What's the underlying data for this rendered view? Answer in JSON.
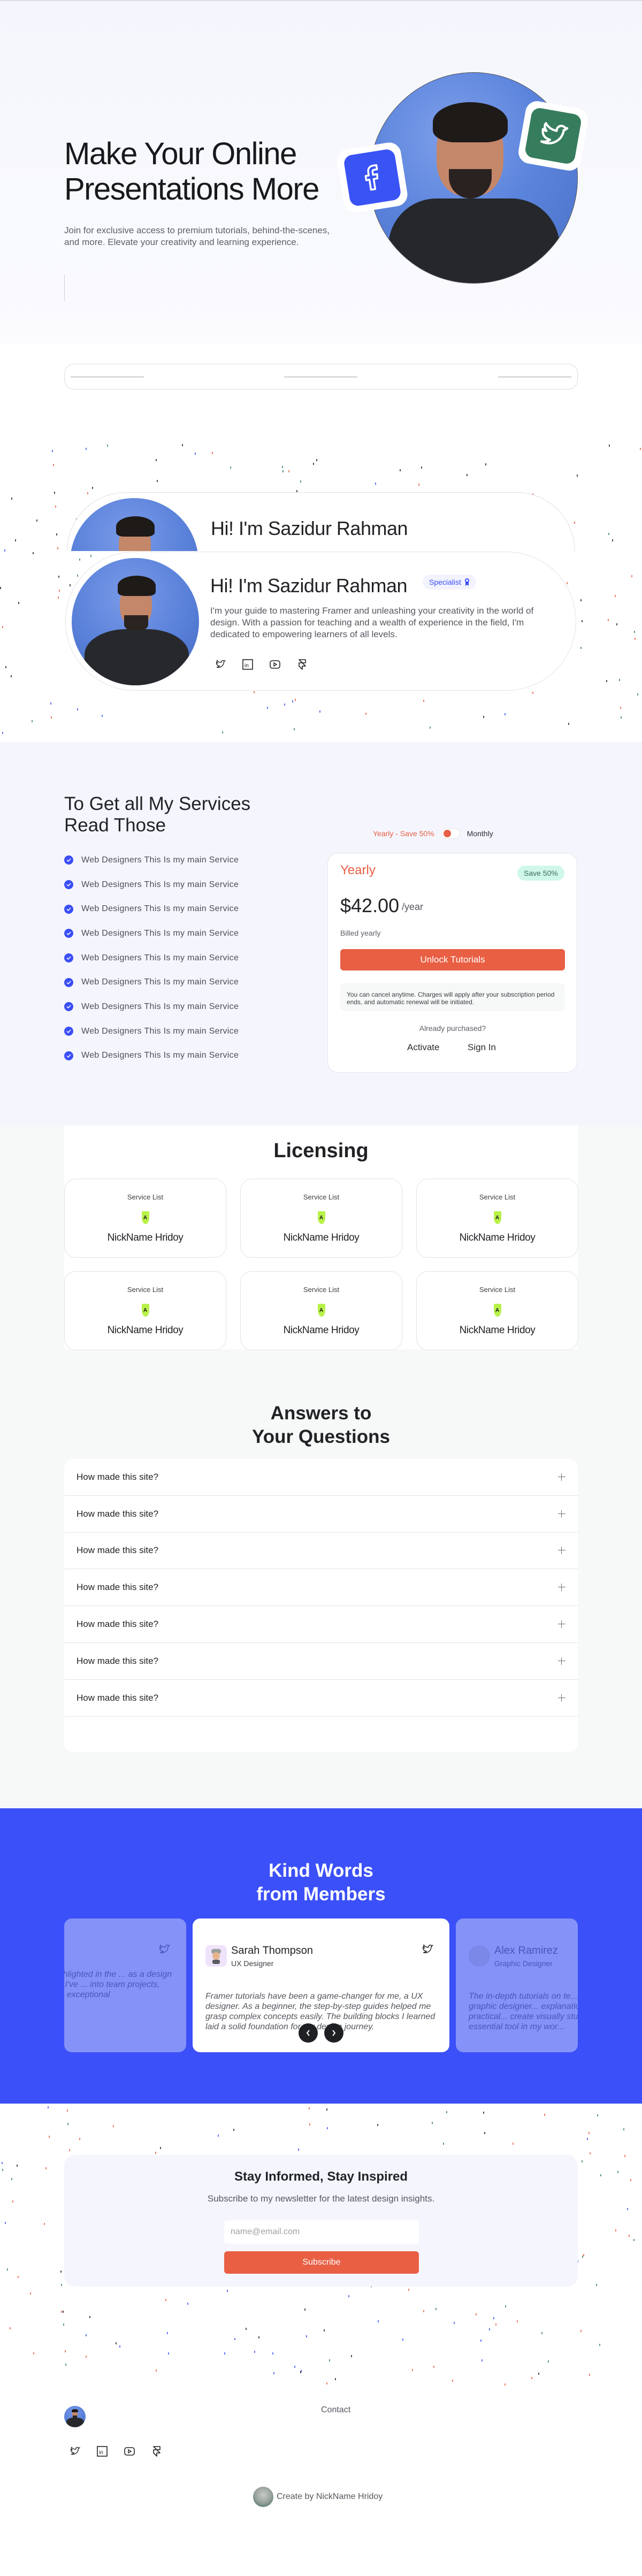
{
  "hero": {
    "title": "Make Your Online Presentations More",
    "subtitle": "Join for exclusive access to premium tutorials, behind-the-scenes, and more. Elevate your creativity and learning experience.",
    "badges": [
      {
        "icon": "facebook-icon",
        "color": "#3a53f5"
      },
      {
        "icon": "twitter-icon",
        "color": "#367d5d"
      }
    ]
  },
  "about": {
    "back_name": "Hi! I'm Sazidur Rahman",
    "name": "Hi! I'm Sazidur Rahman",
    "badge": "Specialist",
    "description": "I'm your guide to mastering Framer and unleashing your creativity in the world of design. With a passion for teaching and a wealth of experience in the field, I'm dedicated to empowering learners of all levels.",
    "socials": [
      "twitter-icon",
      "linkedin-icon",
      "youtube-icon",
      "framer-icon"
    ]
  },
  "services": {
    "title": "To Get all My Services Read Those",
    "items": [
      "Web Designers This Is my main Service",
      "Web Designers This Is my main Service",
      "Web Designers This Is my main Service",
      "Web Designers This Is my main Service",
      "Web Designers This Is my main Service",
      "Web Designers This Is my main Service",
      "Web Designers This Is my main Service",
      "Web Designers This Is my main Service",
      "Web Designers This Is my main Service"
    ]
  },
  "pricing": {
    "toggle_yearly": "Yearly - Save 50%",
    "toggle_monthly": "Monthly",
    "toggle_state": "yearly",
    "plan": "Yearly",
    "save_badge": "Save 50%",
    "price": "$42.00",
    "period": "/year",
    "billed": "Billed yearly",
    "cta": "Unlock Tutorials",
    "note": "You can cancel anytime. Charges will apply after your subscription period ends, and automatic renewal will be initiated.",
    "already": "Already purchased?",
    "activate": "Activate",
    "signin": "Sign In",
    "accent": "#e95f44"
  },
  "licensing": {
    "title": "Licensing",
    "cards": [
      {
        "label": "Service List",
        "name": "NickName Hridoy"
      },
      {
        "label": "Service List",
        "name": "NickName Hridoy"
      },
      {
        "label": "Service List",
        "name": "NickName Hridoy"
      },
      {
        "label": "Service List",
        "name": "NickName Hridoy"
      },
      {
        "label": "Service List",
        "name": "NickName Hridoy"
      },
      {
        "label": "Service List",
        "name": "NickName Hridoy"
      }
    ]
  },
  "faq": {
    "title_line1": "Answers to",
    "title_line2": "Your Questions",
    "items": [
      "How made this site?",
      "How made this site?",
      "How made this site?",
      "How made this site?",
      "How made this site?",
      "How made this site?",
      "How made this site?"
    ]
  },
  "testimonials": {
    "title_line1": "Kind Words",
    "title_line2": "from Members",
    "left_quote": "...ices highlighted in the ... as a design manager. I've ... into team projects, ...creating exceptional",
    "main": {
      "name": "Sarah Thompson",
      "role": "UX Designer",
      "quote": "Framer tutorials have been a game-changer for me, a UX designer. As a beginner, the step-by-step guides helped me grasp complex concepts easily. The building blocks I learned laid a solid foundation for my design journey."
    },
    "right": {
      "name": "Alex Ramirez",
      "role": "Graphic Designer",
      "quote": "The in-depth tutorials on te... skills as a graphic designer... explanations and practical... create visually stunning te... an essential tool in my wor..."
    },
    "brand_color": "#3b50f8"
  },
  "newsletter": {
    "title": "Stay Informed, Stay Inspired",
    "subtitle": "Subscribe to my newsletter for the latest design insights.",
    "email_placeholder": "name@email.com",
    "email_value": "",
    "button": "Subscribe"
  },
  "footer": {
    "contact": "Contact",
    "socials": [
      "twitter-icon",
      "linkedin-icon",
      "youtube-icon",
      "framer-icon"
    ],
    "credit": "Create by NickName Hridoy"
  }
}
